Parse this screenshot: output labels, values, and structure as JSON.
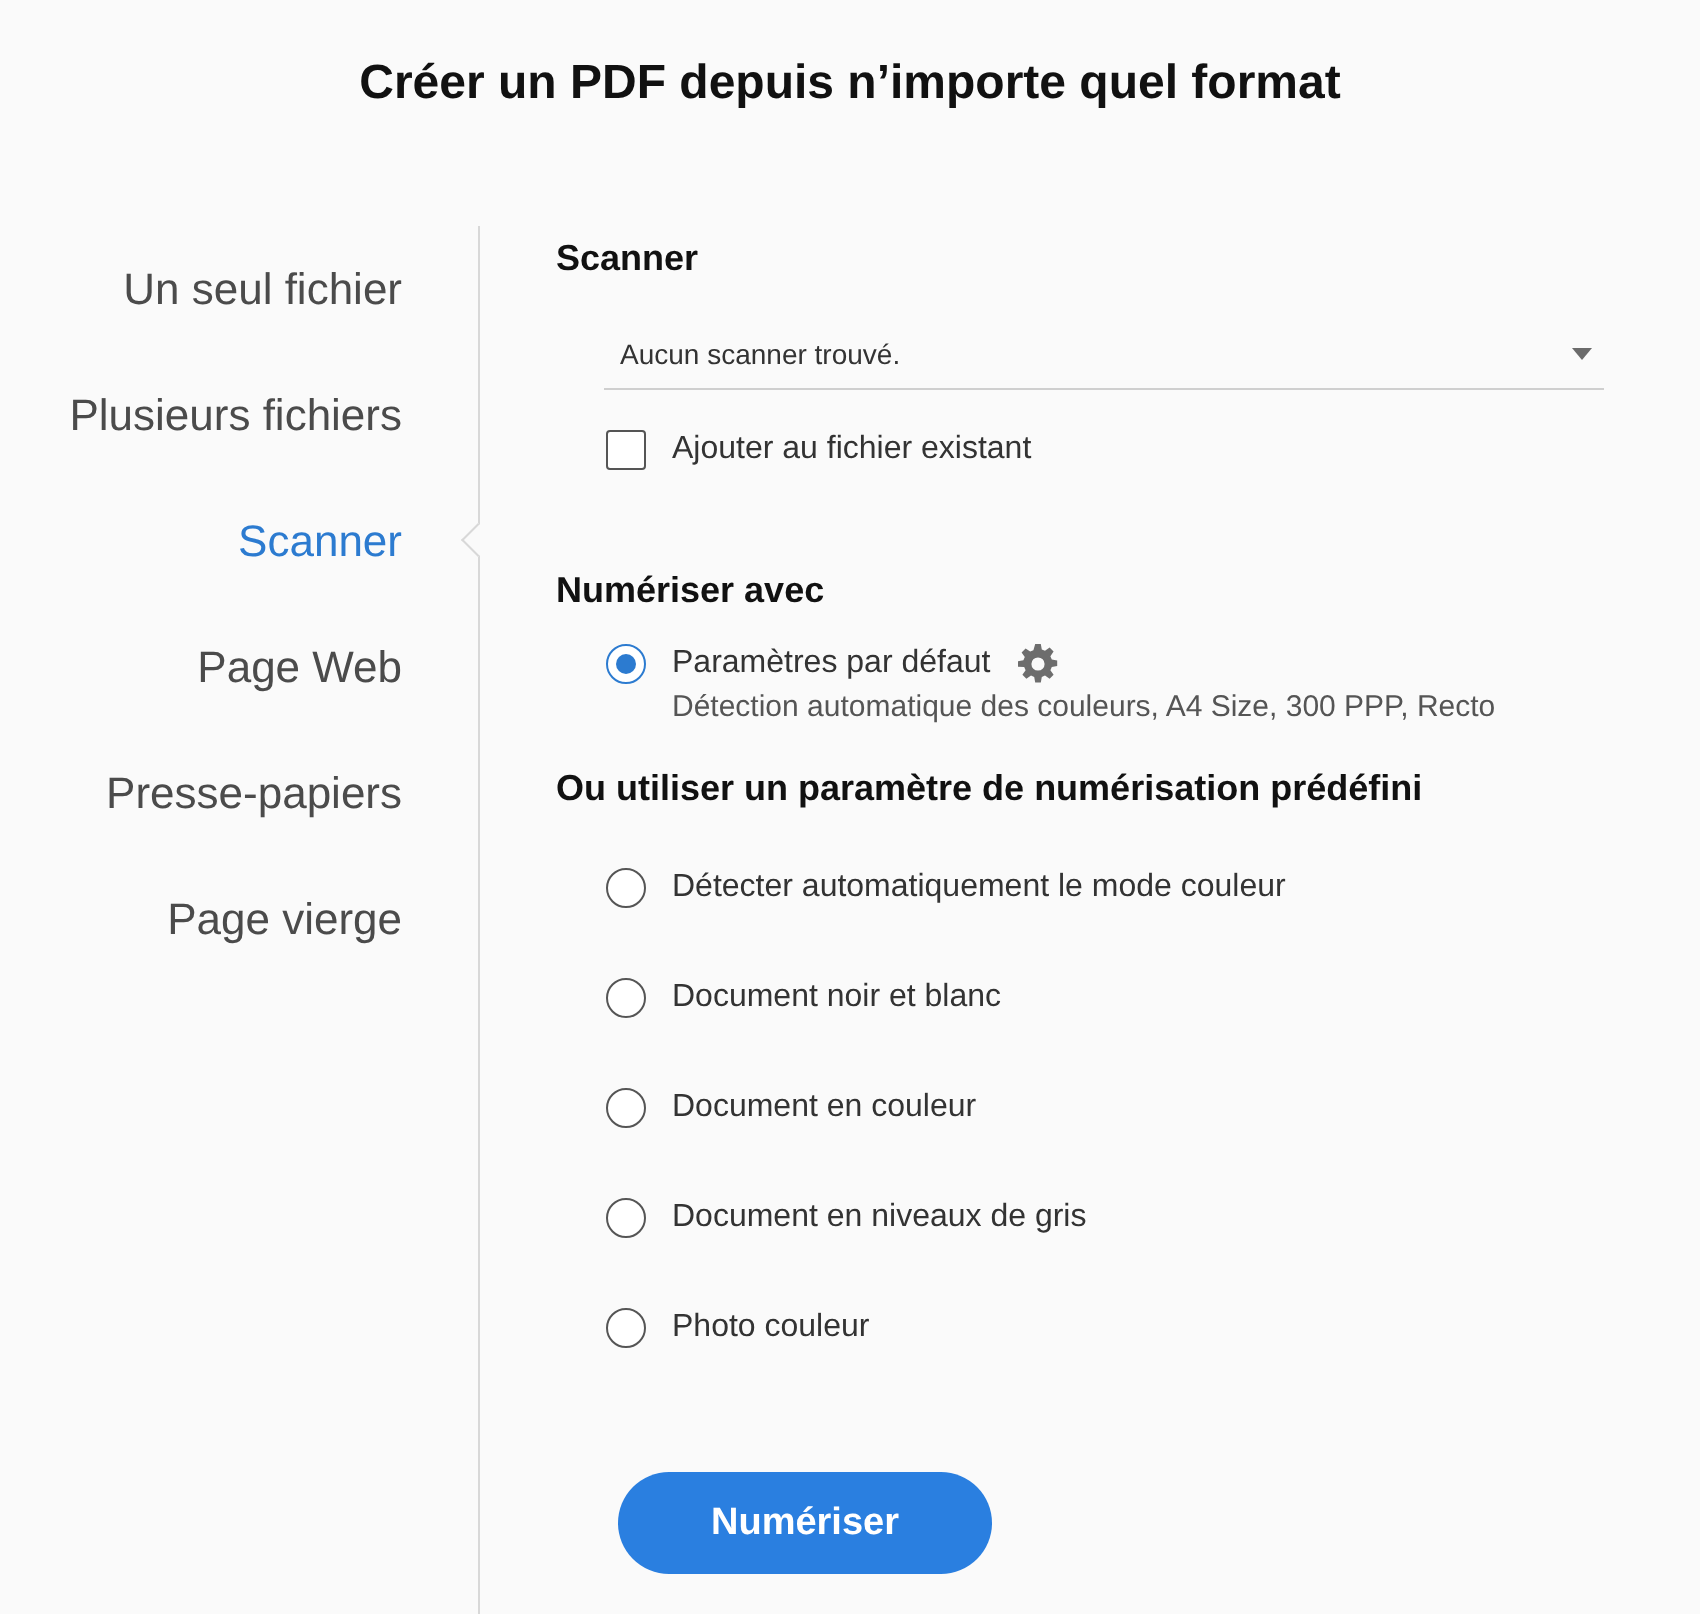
{
  "title": "Créer un PDF depuis n’importe quel format",
  "sidebar": {
    "items": [
      {
        "label": "Un seul fichier",
        "selected": false
      },
      {
        "label": "Plusieurs fichiers",
        "selected": false
      },
      {
        "label": "Scanner",
        "selected": true
      },
      {
        "label": "Page Web",
        "selected": false
      },
      {
        "label": "Presse-papiers",
        "selected": false
      },
      {
        "label": "Page vierge",
        "selected": false
      }
    ]
  },
  "scanner": {
    "heading": "Scanner",
    "dropdown": {
      "value": "Aucun scanner trouvé."
    },
    "append": {
      "label": "Ajouter au fichier existant",
      "checked": false
    }
  },
  "scan_with": {
    "heading": "Numériser avec",
    "options": [
      {
        "label": "Paramètres par défaut",
        "description": "Détection automatique des couleurs, A4 Size, 300 PPP, Recto",
        "selected": true,
        "settings": true
      }
    ]
  },
  "presets": {
    "heading": "Ou utiliser un paramètre de numérisation prédéfini",
    "options": [
      {
        "label": "Détecter automatiquement le mode couleur",
        "selected": false
      },
      {
        "label": "Document noir et blanc",
        "selected": false
      },
      {
        "label": "Document en couleur",
        "selected": false
      },
      {
        "label": "Document en niveaux de gris",
        "selected": false
      },
      {
        "label": "Photo couleur",
        "selected": false
      }
    ]
  },
  "button": "Numériser"
}
